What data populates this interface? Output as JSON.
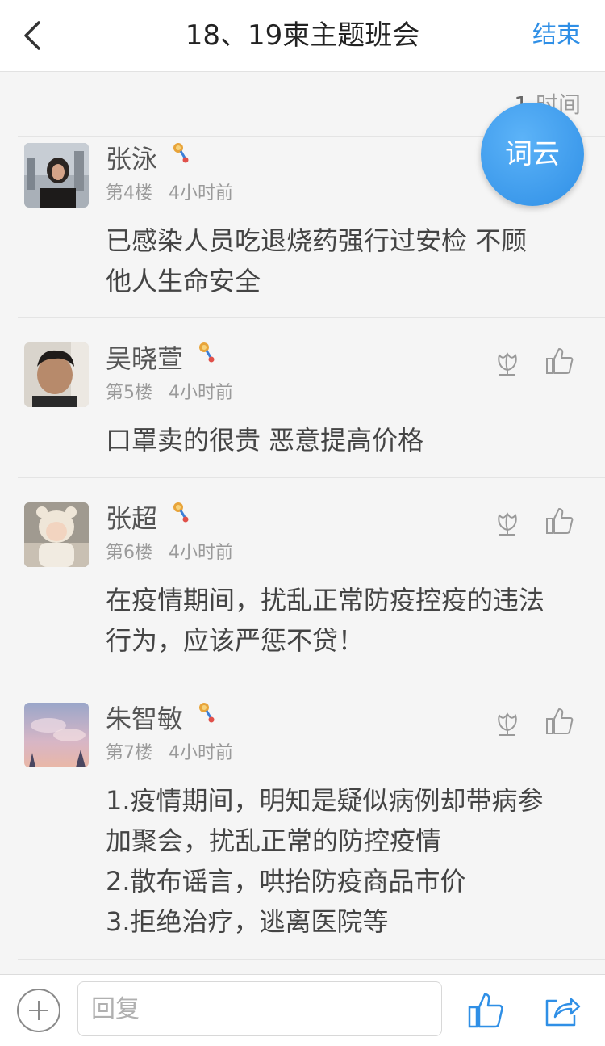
{
  "header": {
    "title": "18、19柬主题班会",
    "end_label": "结束"
  },
  "filter": {
    "first": "1",
    "second": "时间"
  },
  "wordcloud_button": "词云",
  "posts": [
    {
      "name": "张泳",
      "floor": "第4楼",
      "time": "4小时前",
      "content": "已感染人员吃退烧药强行过安检  不顾\n他人生命安全"
    },
    {
      "name": "吴晓萱",
      "floor": "第5楼",
      "time": "4小时前",
      "content": "口罩卖的很贵 恶意提高价格"
    },
    {
      "name": "张超",
      "floor": "第6楼",
      "time": "4小时前",
      "content": "在疫情期间，扰乱正常防疫控疫的违法\n行为，应该严惩不贷！"
    },
    {
      "name": "朱智敏",
      "floor": "第7楼",
      "time": "4小时前",
      "content": "1.疫情期间，明知是疑似病例却带病参\n加聚会，扰乱正常的防控疫情\n2.散布谣言，哄抬防疫商品市价\n3.拒绝治疗，逃离医院等"
    }
  ],
  "bottom": {
    "reply_placeholder": "回复"
  },
  "icons": {
    "back": "chevron-left-icon",
    "medal": "medal-icon",
    "flower": "flower-icon",
    "like": "thumbs-up-icon",
    "plus": "plus-circle-icon",
    "share": "share-icon"
  },
  "colors": {
    "accent": "#2f8fe6",
    "background": "#f5f5f5",
    "text": "#444444",
    "meta": "#9a9a9a"
  }
}
